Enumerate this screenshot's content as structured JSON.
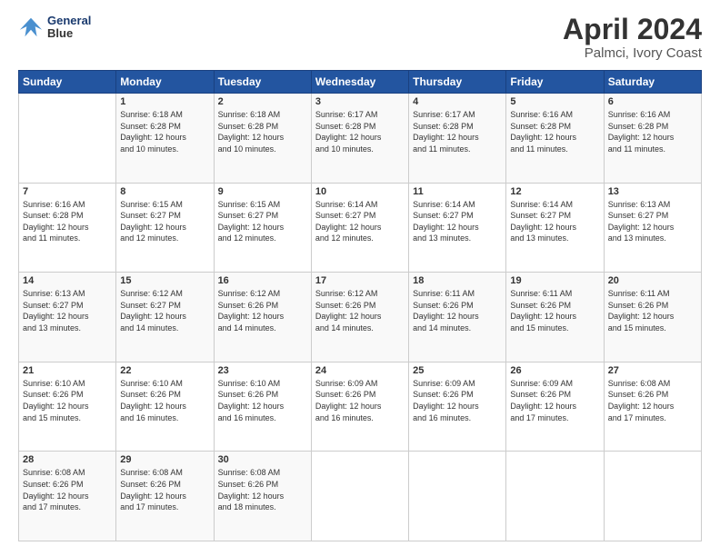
{
  "header": {
    "logo_line1": "General",
    "logo_line2": "Blue",
    "title": "April 2024",
    "subtitle": "Palmci, Ivory Coast"
  },
  "calendar": {
    "days_of_week": [
      "Sunday",
      "Monday",
      "Tuesday",
      "Wednesday",
      "Thursday",
      "Friday",
      "Saturday"
    ],
    "weeks": [
      [
        {
          "day": "",
          "info": ""
        },
        {
          "day": "1",
          "info": "Sunrise: 6:18 AM\nSunset: 6:28 PM\nDaylight: 12 hours\nand 10 minutes."
        },
        {
          "day": "2",
          "info": "Sunrise: 6:18 AM\nSunset: 6:28 PM\nDaylight: 12 hours\nand 10 minutes."
        },
        {
          "day": "3",
          "info": "Sunrise: 6:17 AM\nSunset: 6:28 PM\nDaylight: 12 hours\nand 10 minutes."
        },
        {
          "day": "4",
          "info": "Sunrise: 6:17 AM\nSunset: 6:28 PM\nDaylight: 12 hours\nand 11 minutes."
        },
        {
          "day": "5",
          "info": "Sunrise: 6:16 AM\nSunset: 6:28 PM\nDaylight: 12 hours\nand 11 minutes."
        },
        {
          "day": "6",
          "info": "Sunrise: 6:16 AM\nSunset: 6:28 PM\nDaylight: 12 hours\nand 11 minutes."
        }
      ],
      [
        {
          "day": "7",
          "info": "Sunrise: 6:16 AM\nSunset: 6:28 PM\nDaylight: 12 hours\nand 11 minutes."
        },
        {
          "day": "8",
          "info": "Sunrise: 6:15 AM\nSunset: 6:27 PM\nDaylight: 12 hours\nand 12 minutes."
        },
        {
          "day": "9",
          "info": "Sunrise: 6:15 AM\nSunset: 6:27 PM\nDaylight: 12 hours\nand 12 minutes."
        },
        {
          "day": "10",
          "info": "Sunrise: 6:14 AM\nSunset: 6:27 PM\nDaylight: 12 hours\nand 12 minutes."
        },
        {
          "day": "11",
          "info": "Sunrise: 6:14 AM\nSunset: 6:27 PM\nDaylight: 12 hours\nand 13 minutes."
        },
        {
          "day": "12",
          "info": "Sunrise: 6:14 AM\nSunset: 6:27 PM\nDaylight: 12 hours\nand 13 minutes."
        },
        {
          "day": "13",
          "info": "Sunrise: 6:13 AM\nSunset: 6:27 PM\nDaylight: 12 hours\nand 13 minutes."
        }
      ],
      [
        {
          "day": "14",
          "info": "Sunrise: 6:13 AM\nSunset: 6:27 PM\nDaylight: 12 hours\nand 13 minutes."
        },
        {
          "day": "15",
          "info": "Sunrise: 6:12 AM\nSunset: 6:27 PM\nDaylight: 12 hours\nand 14 minutes."
        },
        {
          "day": "16",
          "info": "Sunrise: 6:12 AM\nSunset: 6:26 PM\nDaylight: 12 hours\nand 14 minutes."
        },
        {
          "day": "17",
          "info": "Sunrise: 6:12 AM\nSunset: 6:26 PM\nDaylight: 12 hours\nand 14 minutes."
        },
        {
          "day": "18",
          "info": "Sunrise: 6:11 AM\nSunset: 6:26 PM\nDaylight: 12 hours\nand 14 minutes."
        },
        {
          "day": "19",
          "info": "Sunrise: 6:11 AM\nSunset: 6:26 PM\nDaylight: 12 hours\nand 15 minutes."
        },
        {
          "day": "20",
          "info": "Sunrise: 6:11 AM\nSunset: 6:26 PM\nDaylight: 12 hours\nand 15 minutes."
        }
      ],
      [
        {
          "day": "21",
          "info": "Sunrise: 6:10 AM\nSunset: 6:26 PM\nDaylight: 12 hours\nand 15 minutes."
        },
        {
          "day": "22",
          "info": "Sunrise: 6:10 AM\nSunset: 6:26 PM\nDaylight: 12 hours\nand 16 minutes."
        },
        {
          "day": "23",
          "info": "Sunrise: 6:10 AM\nSunset: 6:26 PM\nDaylight: 12 hours\nand 16 minutes."
        },
        {
          "day": "24",
          "info": "Sunrise: 6:09 AM\nSunset: 6:26 PM\nDaylight: 12 hours\nand 16 minutes."
        },
        {
          "day": "25",
          "info": "Sunrise: 6:09 AM\nSunset: 6:26 PM\nDaylight: 12 hours\nand 16 minutes."
        },
        {
          "day": "26",
          "info": "Sunrise: 6:09 AM\nSunset: 6:26 PM\nDaylight: 12 hours\nand 17 minutes."
        },
        {
          "day": "27",
          "info": "Sunrise: 6:08 AM\nSunset: 6:26 PM\nDaylight: 12 hours\nand 17 minutes."
        }
      ],
      [
        {
          "day": "28",
          "info": "Sunrise: 6:08 AM\nSunset: 6:26 PM\nDaylight: 12 hours\nand 17 minutes."
        },
        {
          "day": "29",
          "info": "Sunrise: 6:08 AM\nSunset: 6:26 PM\nDaylight: 12 hours\nand 17 minutes."
        },
        {
          "day": "30",
          "info": "Sunrise: 6:08 AM\nSunset: 6:26 PM\nDaylight: 12 hours\nand 18 minutes."
        },
        {
          "day": "",
          "info": ""
        },
        {
          "day": "",
          "info": ""
        },
        {
          "day": "",
          "info": ""
        },
        {
          "day": "",
          "info": ""
        }
      ]
    ]
  }
}
